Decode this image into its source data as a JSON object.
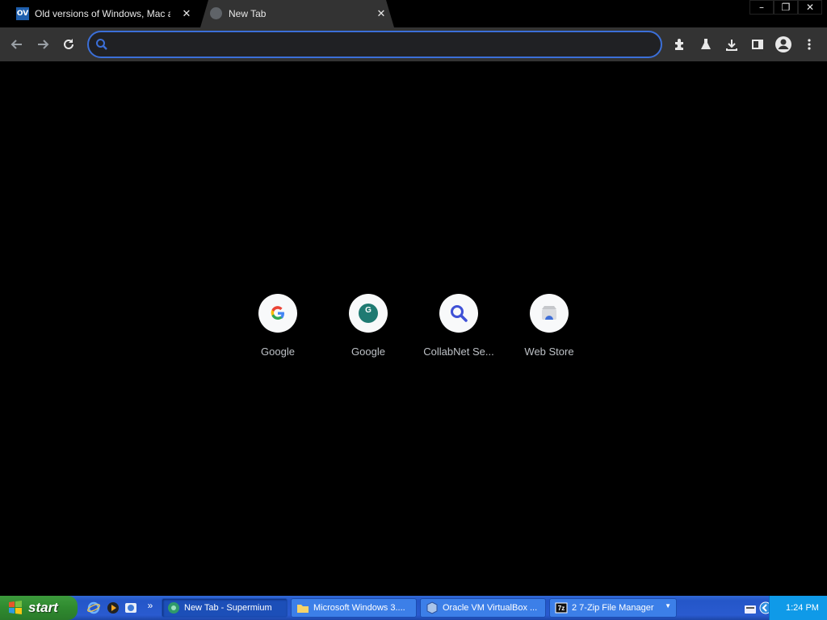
{
  "tabs": [
    {
      "title": "Old versions of Windows, Mac and Linux software",
      "favicon": "OV"
    },
    {
      "title": "New Tab"
    }
  ],
  "omnibox": {
    "value": "",
    "placeholder": ""
  },
  "shortcuts": [
    {
      "label": "Google",
      "icon": "google-g-icon"
    },
    {
      "label": "Google",
      "icon": "google-g-badge-icon"
    },
    {
      "label": "CollabNet Se...",
      "icon": "search-icon"
    },
    {
      "label": "Web Store",
      "icon": "web-store-icon"
    }
  ],
  "taskbar": {
    "start_label": "start",
    "overflow": "»",
    "tasks": [
      {
        "label": "New Tab - Supermium"
      },
      {
        "label": "Microsoft Windows 3...."
      },
      {
        "label": "Oracle VM VirtualBox ..."
      },
      {
        "label": "2 7-Zip File Manager"
      }
    ],
    "clock": "1:24 PM"
  },
  "colors": {
    "accent": "#3b6fd8",
    "toolbar": "#333333",
    "taskbar": "#2456c8",
    "start": "#2f8a2f"
  }
}
